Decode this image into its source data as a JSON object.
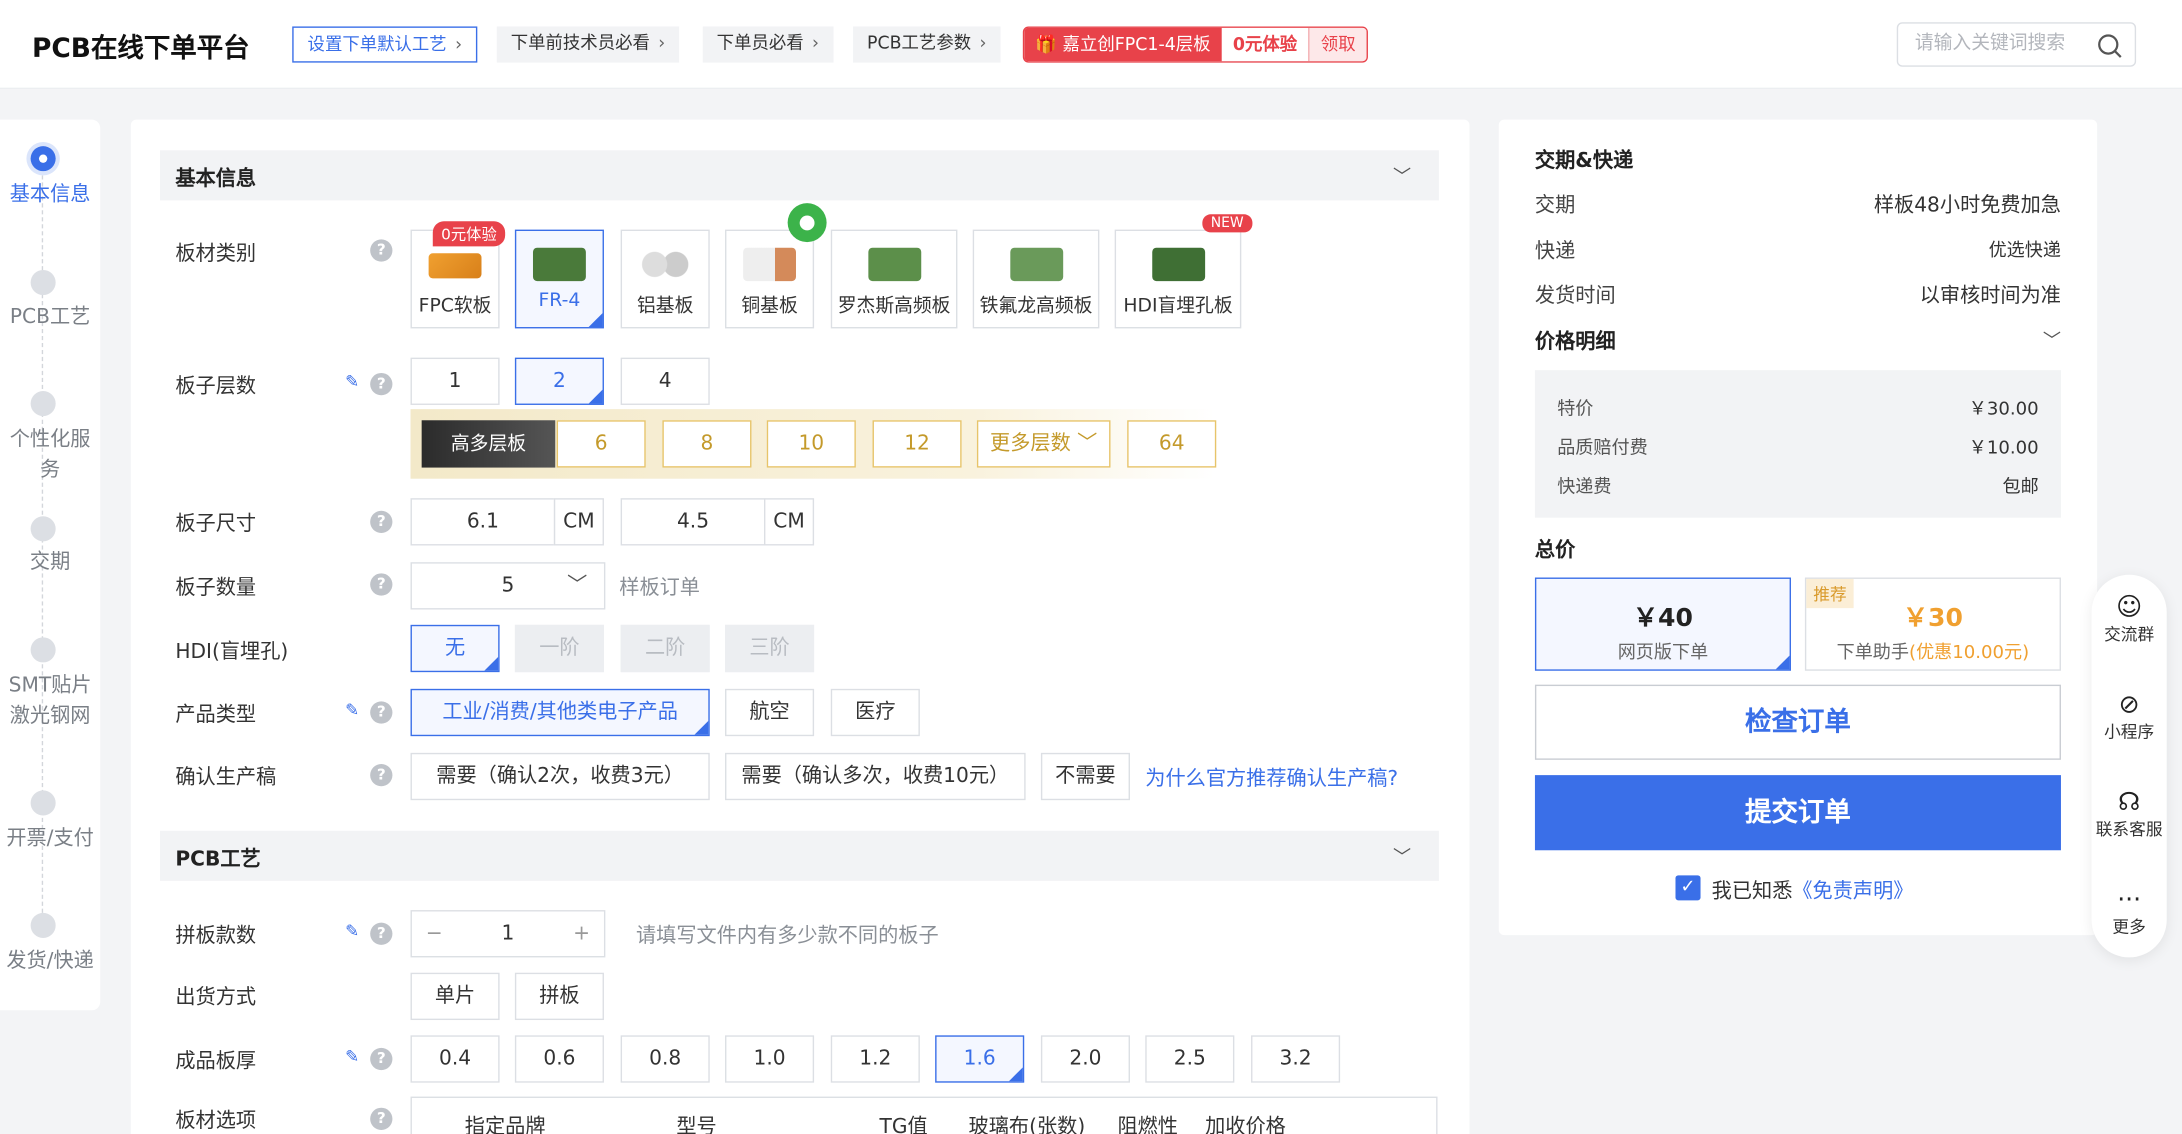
{
  "header": {
    "logo": "PCB在线下单平台",
    "chips": [
      {
        "label": "设置下单默认工艺"
      },
      {
        "label": "下单前技术员必看"
      },
      {
        "label": "下单员必看"
      },
      {
        "label": "PCB工艺参数"
      }
    ],
    "promo": {
      "main": "嘉立创FPC1-4层板",
      "free": "0元体验",
      "claim": "领取"
    },
    "search": {
      "placeholder": "请输入关键词搜索"
    }
  },
  "steps": [
    {
      "label": "基本信息"
    },
    {
      "label": "PCB工艺"
    },
    {
      "label": "个性化服务"
    },
    {
      "label": "交期"
    },
    {
      "label": "SMT贴片",
      "label2": "激光钢网"
    },
    {
      "label": "开票/支付"
    },
    {
      "label": "发货/快递"
    }
  ],
  "basic": {
    "section_title": "基本信息",
    "material": {
      "label": "板材类别",
      "options": [
        "FPC软板",
        "FR-4",
        "铝基板",
        "铜基板",
        "罗杰斯高频板",
        "铁氟龙高频板",
        "HDI盲埋孔板"
      ],
      "selected": "FR-4",
      "tag_free": "0元体验",
      "tag_new": "NEW"
    },
    "layers": {
      "label": "板子层数",
      "options": [
        "1",
        "2",
        "4"
      ],
      "selected": "2",
      "premium_label": "高多层板",
      "premium": [
        "6",
        "8",
        "10",
        "12"
      ],
      "more": "更多层数",
      "max": "64"
    },
    "size": {
      "label": "板子尺寸",
      "w": "6.1",
      "h": "4.5",
      "unit": "CM"
    },
    "qty": {
      "label": "板子数量",
      "value": "5",
      "hint": "样板订单"
    },
    "hdi": {
      "label": "HDI(盲埋孔)",
      "options": [
        "无",
        "一阶",
        "二阶",
        "三阶"
      ],
      "selected": "无"
    },
    "product": {
      "label": "产品类型",
      "options": [
        "工业/消费/其他类电子产品",
        "航空",
        "医疗"
      ],
      "selected": "工业/消费/其他类电子产品"
    },
    "confirm": {
      "label": "确认生产稿",
      "options": [
        "需要（确认2次，收费3元）",
        "需要（确认多次，收费10元）",
        "不需要"
      ],
      "link": "为什么官方推荐确认生产稿?"
    }
  },
  "pcb": {
    "section_title": "PCB工艺",
    "panel": {
      "label": "拼板款数",
      "value": "1",
      "hint": "请填写文件内有多少款不同的板子"
    },
    "ship": {
      "label": "出货方式",
      "options": [
        "单片",
        "拼板"
      ]
    },
    "thick": {
      "label": "成品板厚",
      "options": [
        "0.4",
        "0.6",
        "0.8",
        "1.0",
        "1.2",
        "1.6",
        "2.0",
        "2.5",
        "3.2"
      ],
      "selected": "1.6"
    },
    "board_opt": {
      "label": "板材选项",
      "cols": [
        "指定品牌",
        "型号",
        "TG值",
        "玻璃布(张数)",
        "阻燃性",
        "加收价格"
      ]
    }
  },
  "side": {
    "delivery_title": "交期&快递",
    "rows": [
      {
        "k": "交期",
        "v": "样板48小时免费加急"
      },
      {
        "k": "快递",
        "v": "优选快递"
      },
      {
        "k": "发货时间",
        "v": "以审核时间为准"
      }
    ],
    "price_title": "价格明细",
    "prices": [
      {
        "k": "特价",
        "v": "￥30.00"
      },
      {
        "k": "品质赔付费",
        "v": "￥10.00"
      },
      {
        "k": "快递费",
        "v": "包邮"
      }
    ],
    "total_title": "总价",
    "opt1": {
      "price": "￥40",
      "desc": "网页版下单"
    },
    "opt2": {
      "tag": "推荐",
      "price": "￥30",
      "desc": "下单助手",
      "discount": "(优惠10.00元)"
    },
    "check": "检查订单",
    "submit": "提交订单",
    "agree": "我已知悉",
    "disclaimer": "《免责声明》"
  },
  "float": [
    {
      "label": "交流群"
    },
    {
      "label": "小程序"
    },
    {
      "label": "联系客服"
    },
    {
      "label": "更多"
    }
  ]
}
